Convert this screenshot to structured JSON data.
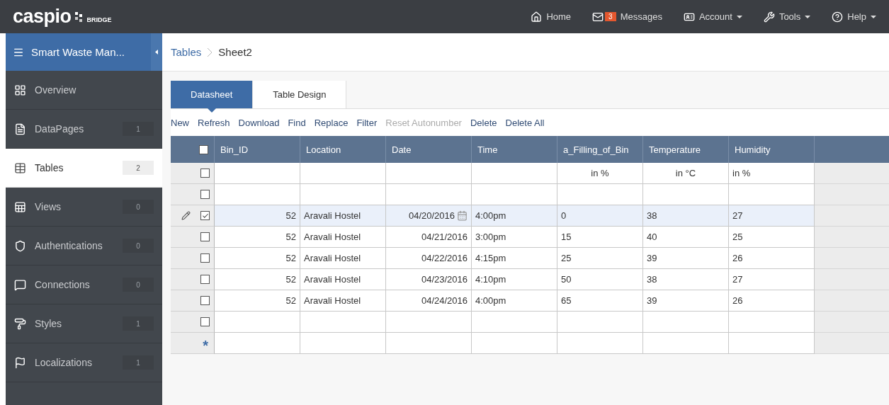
{
  "brand": {
    "name": "caspio",
    "sub": "BRIDGE"
  },
  "nav": [
    {
      "kind": "home",
      "label": "Home",
      "dropdown": false
    },
    {
      "kind": "messages",
      "label": "Messages",
      "badge": "3",
      "dropdown": false
    },
    {
      "kind": "account",
      "label": "Account",
      "dropdown": true
    },
    {
      "kind": "tools",
      "label": "Tools",
      "dropdown": true
    },
    {
      "kind": "help",
      "label": "Help",
      "dropdown": true
    }
  ],
  "app": {
    "title": "Smart Waste Man..."
  },
  "sidebar": {
    "items": [
      {
        "kind": "overview",
        "label": "Overview",
        "selected": false
      },
      {
        "kind": "datapages",
        "label": "DataPages",
        "count": "1",
        "selected": false
      },
      {
        "kind": "tables",
        "label": "Tables",
        "count": "2",
        "selected": true
      },
      {
        "kind": "views",
        "label": "Views",
        "count": "0",
        "selected": false
      },
      {
        "kind": "authentications",
        "label": "Authentications",
        "count": "0",
        "selected": false
      },
      {
        "kind": "connections",
        "label": "Connections",
        "count": "0",
        "selected": false
      },
      {
        "kind": "styles",
        "label": "Styles",
        "count": "1",
        "selected": false
      },
      {
        "kind": "localizations",
        "label": "Localizations",
        "count": "1",
        "selected": false
      }
    ]
  },
  "breadcrumb": [
    "Tables",
    "Sheet2"
  ],
  "tabs": [
    {
      "label": "Datasheet",
      "selected": true
    },
    {
      "label": "Table Design",
      "selected": false
    }
  ],
  "toolbar": [
    {
      "label": "New",
      "disabled": false
    },
    {
      "label": "Refresh",
      "disabled": false
    },
    {
      "label": "Download",
      "disabled": false
    },
    {
      "label": "Find",
      "disabled": false
    },
    {
      "label": "Replace",
      "disabled": false
    },
    {
      "label": "Filter",
      "disabled": false
    },
    {
      "label": "Reset Autonumber",
      "disabled": true
    },
    {
      "label": "Delete",
      "disabled": false
    },
    {
      "label": "Delete All",
      "disabled": false
    }
  ],
  "table": {
    "all_checked": false,
    "columns": [
      "Bin_ID",
      "Location",
      "Date",
      "Time",
      "a_Filling_of_Bin",
      "Temperature",
      "Humidity"
    ],
    "rows": [
      {
        "kind": "units",
        "checked": false,
        "editing": false,
        "cells": [
          null,
          null,
          null,
          null,
          "in %",
          "in °C",
          "in %"
        ]
      },
      {
        "kind": "data",
        "checked": false,
        "editing": false,
        "cells": [
          null,
          null,
          null,
          null,
          null,
          null,
          null
        ]
      },
      {
        "kind": "data",
        "checked": true,
        "editing": true,
        "cells": [
          "52",
          "Aravali Hostel",
          "04/20/2016",
          "4:00pm",
          "0",
          "38",
          "27"
        ]
      },
      {
        "kind": "data",
        "checked": false,
        "editing": false,
        "cells": [
          "52",
          "Aravali Hostel",
          "04/21/2016",
          "3:00pm",
          "15",
          "40",
          "25"
        ]
      },
      {
        "kind": "data",
        "checked": false,
        "editing": false,
        "cells": [
          "52",
          "Aravali Hostel",
          "04/22/2016",
          "4:15pm",
          "25",
          "39",
          "26"
        ]
      },
      {
        "kind": "data",
        "checked": false,
        "editing": false,
        "cells": [
          "52",
          "Aravali Hostel",
          "04/23/2016",
          "4:10pm",
          "50",
          "38",
          "27"
        ]
      },
      {
        "kind": "data",
        "checked": false,
        "editing": false,
        "cells": [
          "52",
          "Aravali Hostel",
          "04/24/2016",
          "4:00pm",
          "65",
          "39",
          "26"
        ]
      },
      {
        "kind": "data",
        "checked": false,
        "editing": false,
        "cells": [
          null,
          null,
          null,
          null,
          null,
          null,
          null
        ]
      },
      {
        "kind": "new",
        "marker": "*",
        "cells": [
          null,
          null,
          null,
          null,
          null,
          null,
          null
        ]
      }
    ]
  }
}
